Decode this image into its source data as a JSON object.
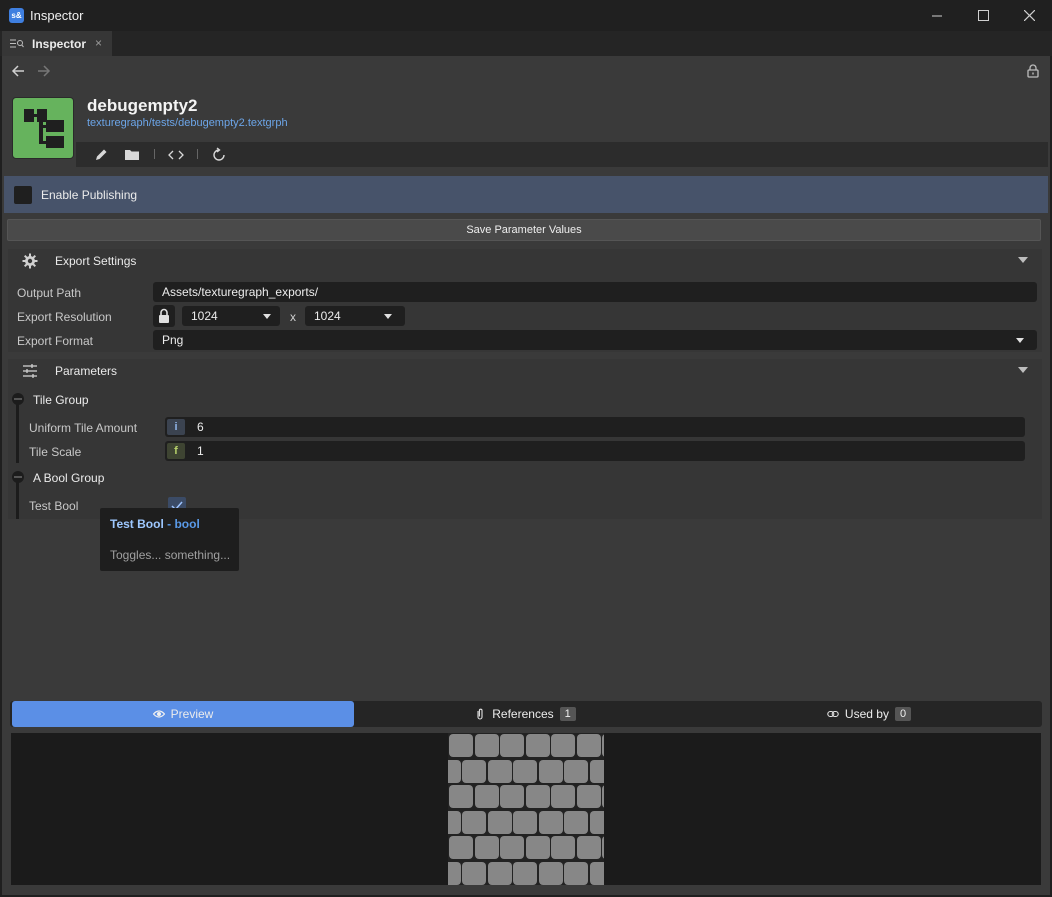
{
  "window": {
    "logo_text": "s&",
    "title": "Inspector"
  },
  "tabs": [
    {
      "label": "Inspector",
      "close": "×"
    }
  ],
  "asset": {
    "name": "debugempty2",
    "path": "texturegraph/tests/debugempty2.textgrph",
    "thumbnail_color": "#66b35d"
  },
  "toolbar_icons": [
    "pencil-icon",
    "folder-icon",
    "code-icon",
    "refresh-icon"
  ],
  "publishing": {
    "label": "Enable Publishing",
    "checked": false
  },
  "save_button": "Save Parameter Values",
  "export_settings": {
    "title": "Export Settings",
    "output_path_label": "Output Path",
    "output_path_value": "Assets/texturegraph_exports/",
    "resolution_label": "Export Resolution",
    "resolution_width": "1024",
    "resolution_separator": "x",
    "resolution_height": "1024",
    "format_label": "Export Format",
    "format_value": "Png"
  },
  "parameters": {
    "title": "Parameters",
    "groups": [
      {
        "title": "Tile Group",
        "items": [
          {
            "label": "Uniform Tile Amount",
            "type_badge": "i",
            "value": "6"
          },
          {
            "label": "Tile Scale",
            "type_badge": "f",
            "value": "1"
          }
        ]
      },
      {
        "title": "A Bool Group",
        "items": [
          {
            "label": "Test Bool",
            "checked": true
          }
        ]
      }
    ]
  },
  "tooltip": {
    "name": "Test Bool",
    "separator": " - ",
    "type": "bool",
    "description": "Toggles... something..."
  },
  "bottom_tabs": [
    {
      "label": "Preview",
      "active": true
    },
    {
      "label": "References",
      "count": "1"
    },
    {
      "label": "Used by",
      "count": "0"
    }
  ],
  "colors": {
    "accent": "#5b8fe6",
    "publish_bar": "#47536a",
    "link": "#6ca5e8"
  }
}
